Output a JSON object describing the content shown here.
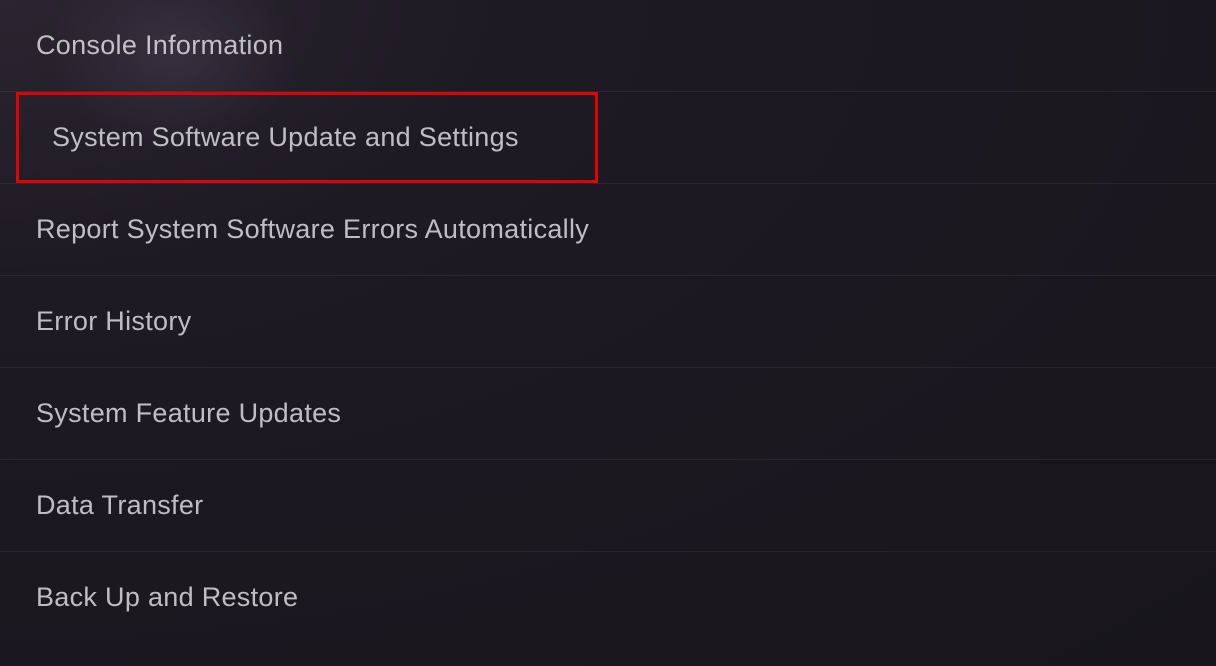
{
  "menu": {
    "items": [
      {
        "label": "Console Information",
        "highlighted": false
      },
      {
        "label": "System Software Update and Settings",
        "highlighted": true
      },
      {
        "label": "Report System Software Errors Automatically",
        "highlighted": false
      },
      {
        "label": "Error History",
        "highlighted": false
      },
      {
        "label": "System Feature Updates",
        "highlighted": false
      },
      {
        "label": "Data Transfer",
        "highlighted": false
      },
      {
        "label": "Back Up and Restore",
        "highlighted": false
      }
    ]
  }
}
